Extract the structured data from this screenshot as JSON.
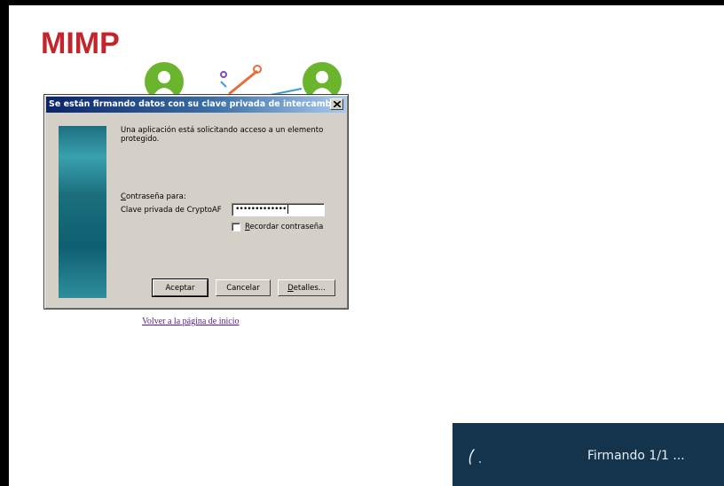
{
  "page": {
    "logo": "MIMP",
    "home_link": "Volver a la página de inicio"
  },
  "dialog": {
    "title": "Se están firmando datos con su clave privada de intercambio",
    "message": "Una aplicación está solicitando acceso a un elemento protegido.",
    "password_label": "Contraseña para:",
    "password_label_mnemonic": "C",
    "password_label_rest": "ontraseña para:",
    "key_name": "Clave privada de CryptoAF",
    "password_value": "•••••••••••••",
    "remember_label": "Recordar contraseña",
    "remember_checked": false,
    "accept_button": "Aceptar",
    "cancel_button": "Cancelar",
    "details_button": "Detalles..."
  },
  "toast": {
    "status": "Firmando 1/1 ..."
  },
  "colors": {
    "logo": "#c3252c",
    "title_bar": "#0a246a",
    "dialog_bg": "#d4d0c8",
    "toast_bg": "#14344d",
    "avatar_green": "#6ab42e",
    "link": "#551a8b"
  },
  "icons": [
    "user-avatar-icon",
    "network-nodes-icon",
    "close-icon",
    "spinner-icon"
  ]
}
